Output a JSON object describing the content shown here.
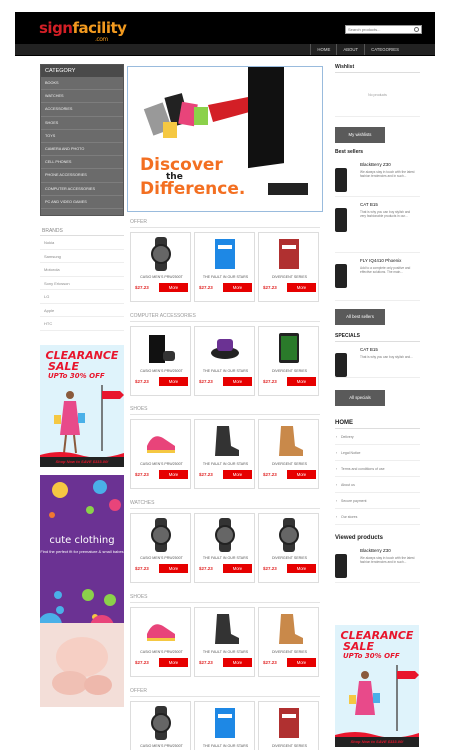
{
  "header": {
    "logo_sign": "sign",
    "logo_facility": "facility",
    "logo_com": ".com",
    "search_placeholder": "Search products...",
    "nav": [
      "HOME",
      "ABOUT",
      "CATEGORIES"
    ]
  },
  "category": {
    "title": "CATEGORY",
    "items": [
      "BOOKS",
      "WATCHES",
      "ACCESSORIES",
      "SHOES",
      "TOYS",
      "CAMERA AND PHOTO",
      "CELL PHONES",
      "PHONE ACCESSORIES",
      "COMPUTER ACCESSORIES",
      "PC AND VIDEO GAMES"
    ]
  },
  "brands": {
    "title": "BRANDS",
    "items": [
      "Nokia",
      "Samsung",
      "Motorola",
      "Sony Ericsson",
      "LG",
      "Apple",
      "HTC"
    ]
  },
  "ad_clearance": {
    "title": "CLEARANCE",
    "line2": "SALE",
    "line3": "UPTo 30% OFF",
    "bottom": "Shop Now to SAVE $333.00!"
  },
  "ad_cute": {
    "title": "cute clothing",
    "subtitle": "Find the perfect fit for premature & small babes"
  },
  "hero": {
    "line1": "Discover",
    "line2": "the",
    "line3": "Difference."
  },
  "sections": [
    {
      "title": "OFFER",
      "products": [
        {
          "name": "CASIO MEN'S PRW2500T",
          "price": "$27.23",
          "more": "More"
        },
        {
          "name": "THE FAULT IN OUR STARS",
          "price": "$27.23",
          "more": "More"
        },
        {
          "name": "DIVERGENT SERIES",
          "price": "$27.23",
          "more": "More"
        }
      ]
    },
    {
      "title": "COMPUTER ACCESSORIES",
      "products": [
        {
          "name": "CASIO MEN'S PRW2500T",
          "price": "$27.23",
          "more": "More"
        },
        {
          "name": "THE FAULT IN OUR STARS",
          "price": "$27.23",
          "more": "More"
        },
        {
          "name": "DIVERGENT SERIES",
          "price": "$27.23",
          "more": "More"
        }
      ]
    },
    {
      "title": "SHOES",
      "products": [
        {
          "name": "CASIO MEN'S PRW2500T",
          "price": "$27.23",
          "more": "More"
        },
        {
          "name": "THE FAULT IN OUR STARS",
          "price": "$27.23",
          "more": "More"
        },
        {
          "name": "DIVERGENT SERIES",
          "price": "$27.23",
          "more": "More"
        }
      ]
    },
    {
      "title": "WATCHES",
      "products": [
        {
          "name": "CASIO MEN'S PRW2500T",
          "price": "$27.23",
          "more": "More"
        },
        {
          "name": "THE FAULT IN OUR STARS",
          "price": "$27.23",
          "more": "More"
        },
        {
          "name": "DIVERGENT SERIES",
          "price": "$27.23",
          "more": "More"
        }
      ]
    },
    {
      "title": "SHOES",
      "products": [
        {
          "name": "CASIO MEN'S PRW2500T",
          "price": "$27.23",
          "more": "More"
        },
        {
          "name": "THE FAULT IN OUR STARS",
          "price": "$27.23",
          "more": "More"
        },
        {
          "name": "DIVERGENT SERIES",
          "price": "$27.23",
          "more": "More"
        }
      ]
    },
    {
      "title": "OFFER",
      "products": [
        {
          "name": "CASIO MEN'S PRW2500T",
          "price": "$27.23",
          "more": "More"
        },
        {
          "name": "THE FAULT IN OUR STARS",
          "price": "$27.23",
          "more": "More"
        },
        {
          "name": "DIVERGENT SERIES",
          "price": "$27.23",
          "more": "More"
        }
      ]
    }
  ],
  "right": {
    "wishlist_title": "Wishlist",
    "wishlist_empty": "No products",
    "wishlist_button": "My wishlists",
    "bestsellers_title": "Best sellers",
    "bestsellers": [
      {
        "name": "BlackBerry Z30",
        "desc": "We always stay in touch with the latest fashion tendencies and in such..."
      },
      {
        "name": "CAT B15",
        "desc": "That is why you can buy stylish and very fashionable products in our..."
      },
      {
        "name": "FLY IQ4410 Phoenix",
        "desc": "Add to a complete only positive and effective solutions. The main..."
      }
    ],
    "bestsellers_button": "All best sellers",
    "specials_title": "SPECIALS",
    "special": {
      "name": "CAT B15",
      "desc": "That is why you can buy stylish and..."
    },
    "specials_button": "All specials",
    "home_title": "HOME",
    "home_items": [
      "Delivery",
      "Legal Notice",
      "Terms and conditions of use",
      "About us",
      "Secure payment",
      "Our stores"
    ],
    "viewed_title": "Viewed products",
    "viewed": {
      "name": "BlackBerry Z30",
      "desc": "We always stay in touch with the latest fashion tendencies and in such..."
    }
  },
  "colors": {
    "brand_red": "#d31f26",
    "brand_orange": "#f29a1f",
    "button_red": "#e60000",
    "price_red": "#e02424"
  }
}
